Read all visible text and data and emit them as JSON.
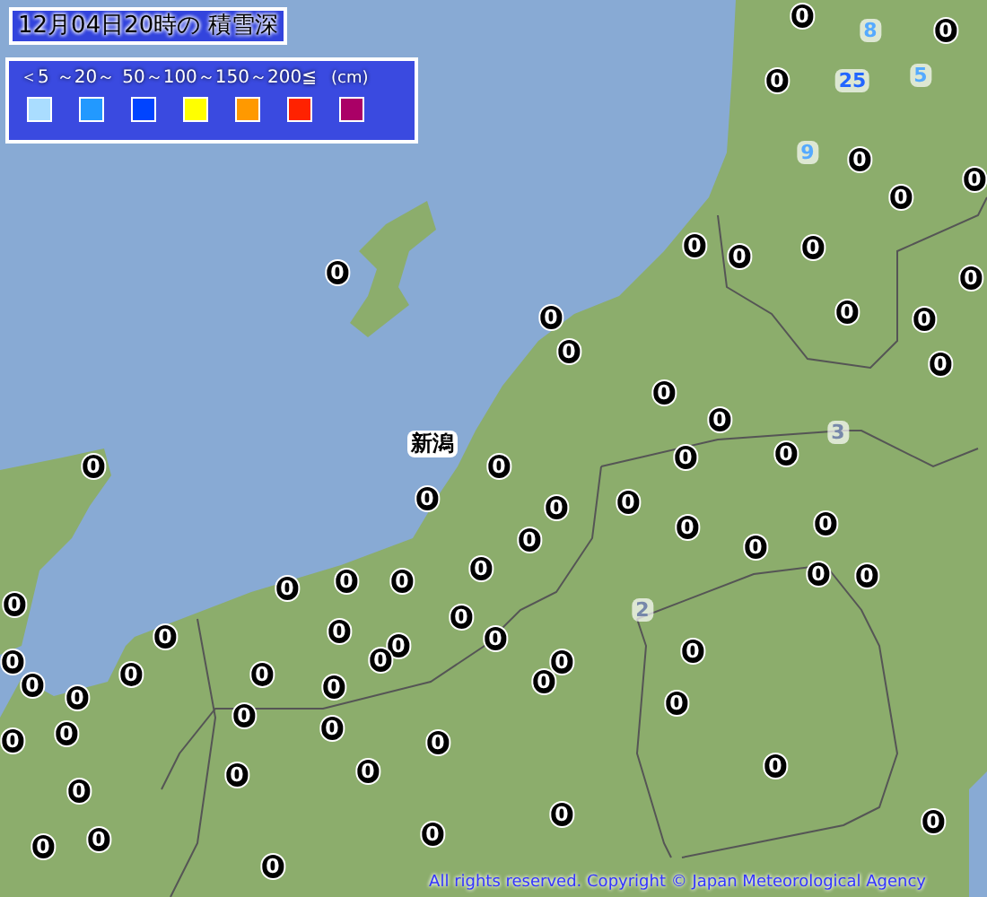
{
  "title": "12月04日20時の 積雪深",
  "legend": {
    "scale": [
      "＜5",
      "～20～",
      "50～100～150～200≦"
    ],
    "unit": "(cm)",
    "swatches": [
      {
        "color": "#aaddff"
      },
      {
        "color": "#2299ff"
      },
      {
        "color": "#0044ff"
      },
      {
        "color": "#ffff00"
      },
      {
        "color": "#ff9900"
      },
      {
        "color": "#ff2200"
      },
      {
        "color": "#aa0066"
      }
    ]
  },
  "city_label": "新潟",
  "readings": [
    {
      "value": "0",
      "color": "#000000"
    },
    {
      "value": "8",
      "color": "#55aaff"
    },
    {
      "value": "0",
      "color": "#000000"
    },
    {
      "value": "0",
      "color": "#000000"
    },
    {
      "value": "25",
      "color": "#2266ff"
    },
    {
      "value": "5",
      "color": "#55aaff"
    },
    {
      "value": "9",
      "color": "#55aaff"
    },
    {
      "value": "0",
      "color": "#000000"
    },
    {
      "value": "0",
      "color": "#000000"
    },
    {
      "value": "0",
      "color": "#000000"
    },
    {
      "value": "0",
      "color": "#000000"
    },
    {
      "value": "0",
      "color": "#000000"
    },
    {
      "value": "0",
      "color": "#000000"
    },
    {
      "value": "0",
      "color": "#000000"
    },
    {
      "value": "0",
      "color": "#000000"
    },
    {
      "value": "0",
      "color": "#000000"
    },
    {
      "value": "0",
      "color": "#000000"
    },
    {
      "value": "0",
      "color": "#000000"
    },
    {
      "value": "0",
      "color": "#000000"
    },
    {
      "value": "0",
      "color": "#000000"
    },
    {
      "value": "0",
      "color": "#000000"
    },
    {
      "value": "0",
      "color": "#000000"
    },
    {
      "value": "3",
      "color": "#7788aa"
    },
    {
      "value": "0",
      "color": "#000000"
    },
    {
      "value": "0",
      "color": "#000000"
    },
    {
      "value": "0",
      "color": "#000000"
    },
    {
      "value": "0",
      "color": "#000000"
    },
    {
      "value": "0",
      "color": "#000000"
    },
    {
      "value": "0",
      "color": "#000000"
    },
    {
      "value": "0",
      "color": "#000000"
    },
    {
      "value": "0",
      "color": "#000000"
    },
    {
      "value": "0",
      "color": "#000000"
    },
    {
      "value": "0",
      "color": "#000000"
    },
    {
      "value": "0",
      "color": "#000000"
    },
    {
      "value": "0",
      "color": "#000000"
    },
    {
      "value": "0",
      "color": "#000000"
    },
    {
      "value": "0",
      "color": "#000000"
    },
    {
      "value": "0",
      "color": "#000000"
    },
    {
      "value": "0",
      "color": "#000000"
    },
    {
      "value": "0",
      "color": "#000000"
    },
    {
      "value": "0",
      "color": "#000000"
    },
    {
      "value": "0",
      "color": "#000000"
    },
    {
      "value": "2",
      "color": "#7788aa"
    },
    {
      "value": "0",
      "color": "#000000"
    },
    {
      "value": "0",
      "color": "#000000"
    },
    {
      "value": "0",
      "color": "#000000"
    },
    {
      "value": "0",
      "color": "#000000"
    },
    {
      "value": "0",
      "color": "#000000"
    },
    {
      "value": "0",
      "color": "#000000"
    },
    {
      "value": "0",
      "color": "#000000"
    },
    {
      "value": "0",
      "color": "#000000"
    },
    {
      "value": "0",
      "color": "#000000"
    },
    {
      "value": "0",
      "color": "#000000"
    },
    {
      "value": "0",
      "color": "#000000"
    },
    {
      "value": "0",
      "color": "#000000"
    },
    {
      "value": "0",
      "color": "#000000"
    },
    {
      "value": "0",
      "color": "#000000"
    },
    {
      "value": "0",
      "color": "#000000"
    },
    {
      "value": "0",
      "color": "#000000"
    },
    {
      "value": "0",
      "color": "#000000"
    },
    {
      "value": "0",
      "color": "#000000"
    },
    {
      "value": "0",
      "color": "#000000"
    },
    {
      "value": "0",
      "color": "#000000"
    },
    {
      "value": "0",
      "color": "#000000"
    },
    {
      "value": "0",
      "color": "#000000"
    },
    {
      "value": "0",
      "color": "#000000"
    },
    {
      "value": "0",
      "color": "#000000"
    },
    {
      "value": "0",
      "color": "#000000"
    },
    {
      "value": "0",
      "color": "#000000"
    },
    {
      "value": "0",
      "color": "#000000"
    },
    {
      "value": "0",
      "color": "#000000"
    },
    {
      "value": "0",
      "color": "#000000"
    },
    {
      "value": "0",
      "color": "#000000"
    }
  ],
  "copyright": "All rights reserved. Copyright © Japan Meteorological Agency"
}
